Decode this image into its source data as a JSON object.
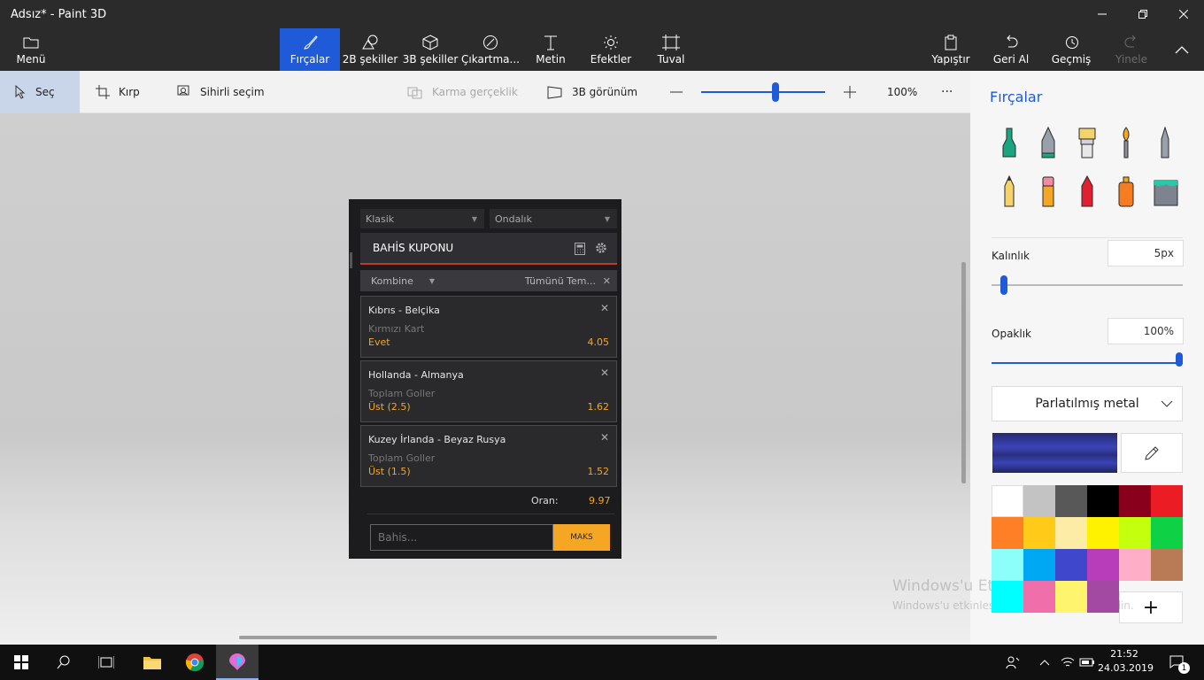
{
  "app": {
    "title": "Adsız* - Paint 3D"
  },
  "ribbon": {
    "menu": "Menü",
    "tools": [
      {
        "label": "Fırçalar",
        "icon": "brush-icon"
      },
      {
        "label": "2B şekiller",
        "icon": "2d-shapes-icon"
      },
      {
        "label": "3B şekiller",
        "icon": "3d-shapes-icon"
      },
      {
        "label": "Çıkartma...",
        "icon": "sticker-icon"
      },
      {
        "label": "Metin",
        "icon": "text-icon"
      },
      {
        "label": "Efektler",
        "icon": "effects-icon"
      },
      {
        "label": "Tuval",
        "icon": "canvas-icon"
      }
    ],
    "paste": "Yapıştır",
    "undo": "Geri Al",
    "history": "Geçmiş",
    "redo": "Yinele"
  },
  "toolbar": {
    "select": "Seç",
    "crop": "Kırp",
    "magic_select": "Sihirli seçim",
    "mixed_reality": "Karma gerçeklik",
    "view3d": "3B görünüm",
    "zoom": "100%",
    "zoom_level": 0.6,
    "more": "···"
  },
  "betslip": {
    "type": "Klasik",
    "odds_format": "Ondalık",
    "header": "BAHİS KUPONU",
    "mode": "Kombine",
    "clear": "Tümünü Tem...",
    "bets": [
      {
        "match": "Kıbrıs - Belçika",
        "market": "Kırmızı Kart",
        "selection": "Evet",
        "odds": "4.05"
      },
      {
        "match": "Hollanda - Almanya",
        "market": "Toplam Goller",
        "selection": "Üst (2.5)",
        "odds": "1.62"
      },
      {
        "match": "Kuzey İrlanda - Beyaz Rusya",
        "market": "Toplam Goller",
        "selection": "Üst (1.5)",
        "odds": "1.52"
      }
    ],
    "total_label": "Oran:",
    "total": "9.97",
    "stake_placeholder": "Bahis...",
    "max": "MAKS"
  },
  "panel": {
    "title": "Fırçalar",
    "thickness_label": "Kalınlık",
    "thickness": "5px",
    "thickness_level": 0.05,
    "opacity_label": "Opaklık",
    "opacity": "100%",
    "opacity_level": 1.0,
    "material": "Parlatılmış metal",
    "colors": [
      "#ffffff",
      "#c3c3c3",
      "#585858",
      "#000000",
      "#88001b",
      "#ec1c24",
      "#ff7f27",
      "#ffca18",
      "#fdeca6",
      "#fff200",
      "#c4ff0e",
      "#0ed145",
      "#8cfffb",
      "#00a8f3",
      "#3f48cc",
      "#b83dba",
      "#ffaec8",
      "#b97a56",
      "#00ffff",
      "#f06eaa",
      "#fff46e",
      "#a349a4"
    ],
    "add_color": "+"
  },
  "watermark": {
    "line1": "Windows'u Etkinleştir",
    "line2": "Windows'u etkinleştirmek için Ayarlar'a gidin."
  },
  "taskbar": {
    "time": "21:52",
    "date": "24.03.2019",
    "notifications": "1"
  }
}
